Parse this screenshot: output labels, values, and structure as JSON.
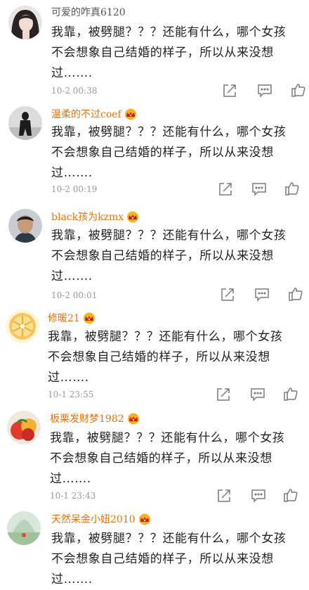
{
  "colors": {
    "normal_name": "#555555",
    "vip_name": "#e8740c",
    "time": "#999999",
    "text": "#222222",
    "icon": "#7a7a7a"
  },
  "icons": {
    "share": "share-icon",
    "comment": "comment-icon",
    "like": "thumbs-up-icon",
    "vip": "crown-badge-icon"
  },
  "comments": [
    {
      "username": "可爱的咋真6120",
      "vip": false,
      "lines": [
        "我靠，被劈腿？？？还能有什么，哪个女孩",
        "不会想象自己结婚的样子，所以从来没想",
        "过……."
      ],
      "time": "10-2 00:38"
    },
    {
      "username": "温柔的不过coef",
      "vip": true,
      "lines": [
        "我靠，被劈腿？？？还能有什么，哪个女孩",
        "不会想象自己结婚的样子，所以从来没想",
        "过……."
      ],
      "time": "10-2 00:19"
    },
    {
      "username": "black孩为kzmx",
      "vip": true,
      "lines": [
        "我靠，被劈腿？？？还能有什么，哪个女孩",
        "不会想象自己结婚的样子，所以从来没想",
        "过……."
      ],
      "time": "10-2 00:01"
    },
    {
      "username": "修暖21",
      "vip": true,
      "lines": [
        "我靠，被劈腿？？？还能有什么，哪个女孩",
        "不会想象自己结婚的样子，所以从来没想",
        "过……."
      ],
      "time": "10-1 23:55"
    },
    {
      "username": "板栗发财梦1982",
      "vip": true,
      "lines": [
        "我靠，被劈腿？？？还能有什么，哪个女孩",
        "不会想象自己结婚的样子，所以从来没想",
        "过……."
      ],
      "time": "10-1 23:43"
    },
    {
      "username": "天然呆金小妞2010",
      "vip": true,
      "lines": [
        "我靠，被劈腿？？？还能有什么，哪个女孩",
        "不会想象自己结婚的样子，所以从来没想",
        "过……."
      ],
      "time": ""
    }
  ]
}
